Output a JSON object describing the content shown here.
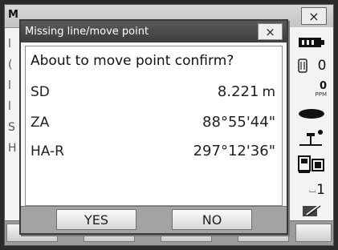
{
  "background_window": {
    "title": "M",
    "close_label": "×",
    "left_fragments": [
      "l",
      "(",
      "l",
      "l",
      "S",
      "H"
    ]
  },
  "right_panel": {
    "battery_icon": "battery-icon",
    "prism_value": "0",
    "ppm_value": "0",
    "ppm_label": "PPM",
    "ch_value": "1"
  },
  "dialog": {
    "title": "Missing line/move point",
    "close_label": "×",
    "message": "About to move point confirm?",
    "rows": [
      {
        "label": "SD",
        "value": "8.221",
        "unit": "m"
      },
      {
        "label": "ZA",
        "value": "88°55'44\""
      },
      {
        "label": "HA-R",
        "value": "297°12'36\""
      }
    ],
    "buttons": {
      "yes": "YES",
      "no": "NO"
    }
  }
}
